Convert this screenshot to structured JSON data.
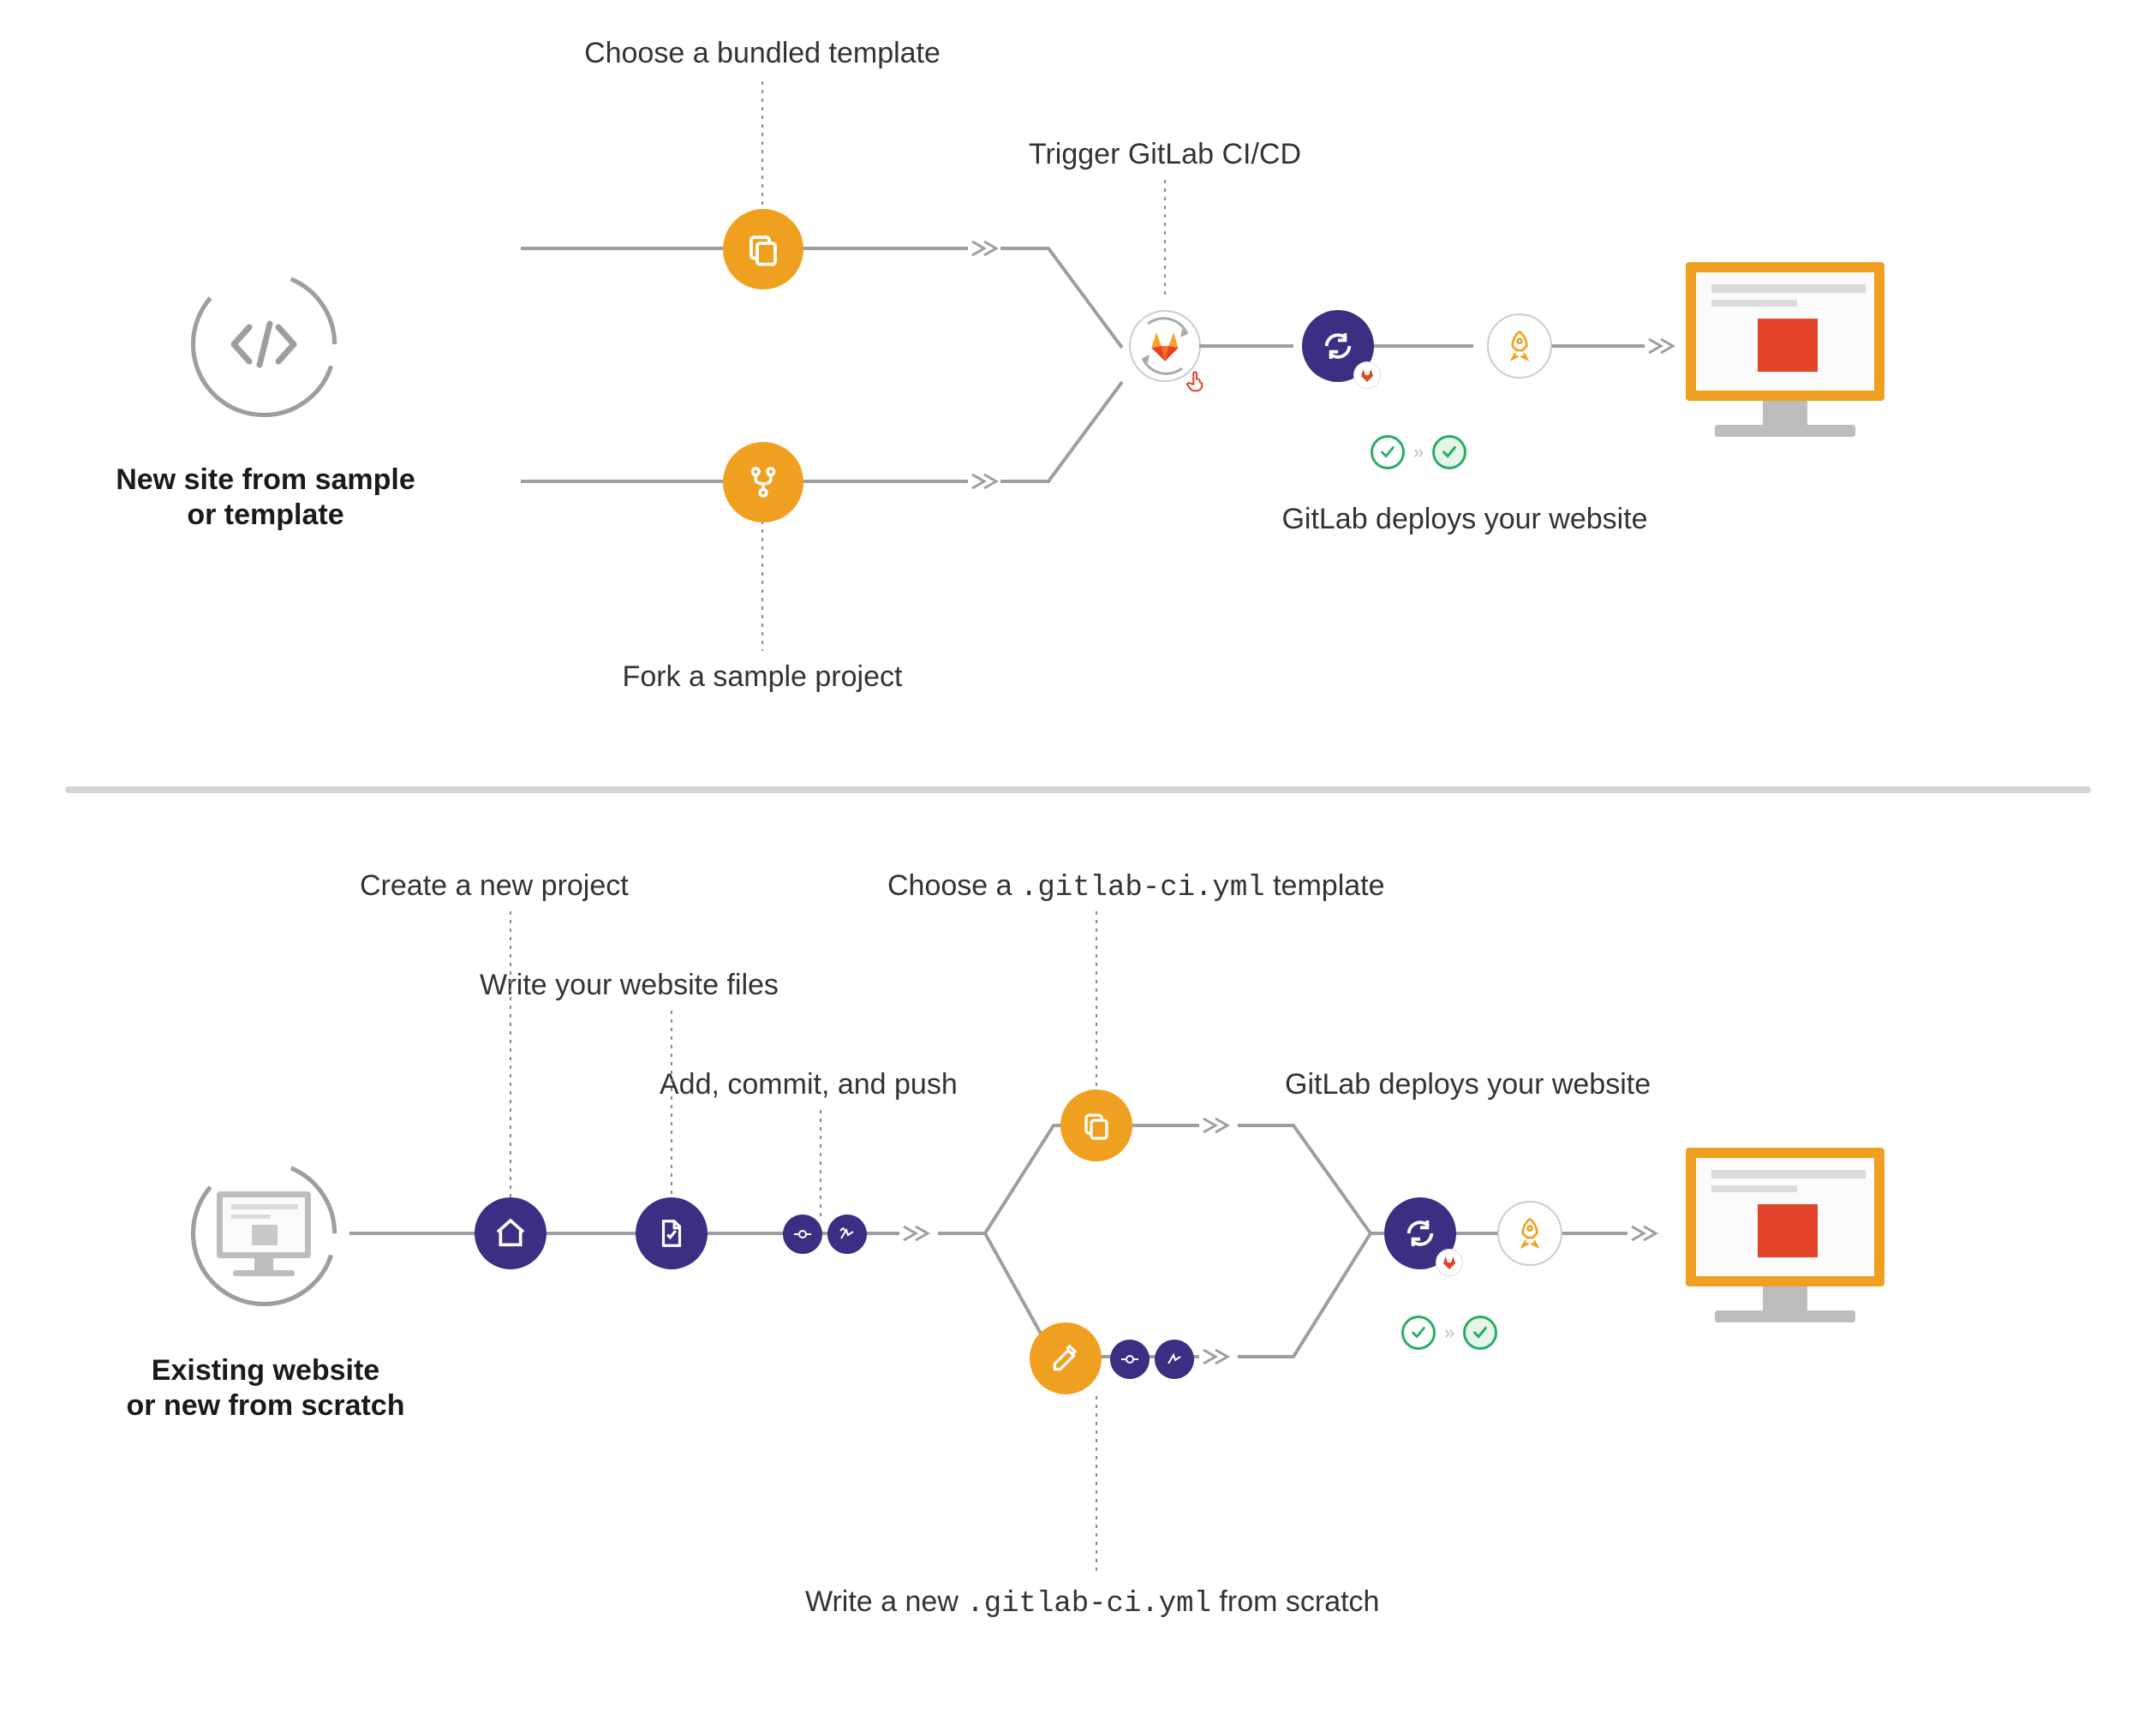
{
  "colors": {
    "orange": "#F0A020",
    "navy": "#3A2F82",
    "grey": "#A0A0A0",
    "red": "#E24329",
    "green": "#27AE60"
  },
  "top": {
    "start_title_line1": "New site from sample",
    "start_title_line2": "or template",
    "choose_template": "Choose a bundled template",
    "fork_sample": "Fork a sample project",
    "trigger_ci": "Trigger GitLab CI/CD",
    "deploy_note": "GitLab deploys your website",
    "icons": {
      "template": "copy-icon",
      "fork": "fork-icon",
      "gitlab": "gitlab-icon",
      "runner": "sync-icon",
      "rocket": "rocket-icon"
    }
  },
  "bottom": {
    "start_title_line1": "Existing website",
    "start_title_line2": "or new from scratch",
    "create_project": "Create a new project",
    "write_files": "Write your website files",
    "add_commit_push": "Add, commit, and push",
    "choose_ci_pre": "Choose a ",
    "choose_ci_code": ".gitlab-ci.yml",
    "choose_ci_post": " template",
    "write_ci_pre": "Write a new ",
    "write_ci_code": ".gitlab-ci.yml",
    "write_ci_post": " from scratch",
    "deploy_note": "GitLab deploys your website",
    "icons": {
      "home": "home-icon",
      "file": "file-icon",
      "git_commit": "commit-icon",
      "git_push": "push-icon",
      "template": "copy-icon",
      "edit": "edit-icon",
      "runner": "sync-icon",
      "rocket": "rocket-icon"
    }
  },
  "status_flow": [
    "pass",
    "pass"
  ]
}
